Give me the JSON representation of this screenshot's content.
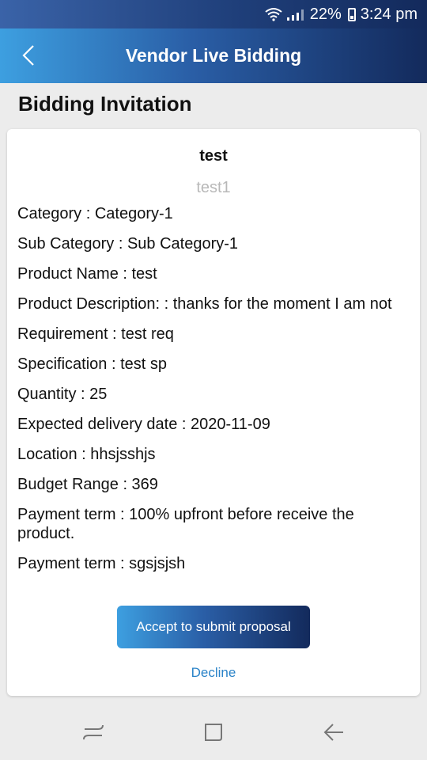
{
  "status_bar": {
    "battery": "22%",
    "time": "3:24 pm"
  },
  "app_bar": {
    "title": "Vendor Live Bidding",
    "back_icon": "chevron-left-icon"
  },
  "section": {
    "title": "Bidding Invitation"
  },
  "card": {
    "title": "test",
    "subtitle": "test1",
    "fields": [
      "Category : Category-1",
      "Sub Category : Sub Category-1",
      "Product Name : test",
      "Product Description: : thanks for the moment I am not",
      "Requirement : test req",
      "Specification : test sp",
      "Quantity : 25",
      "Expected delivery date : 2020-11-09",
      "Location : hhsjsshjs",
      "Budget Range : 369",
      "Payment term : 100% upfront before receive the product.",
      "Payment term : sgsjsjsh"
    ],
    "accept_label": "Accept to submit proposal",
    "decline_label": "Decline"
  },
  "colors": {
    "accent_start": "#3d9fe0",
    "accent_end": "#132a5c",
    "link": "#2a83c8"
  }
}
